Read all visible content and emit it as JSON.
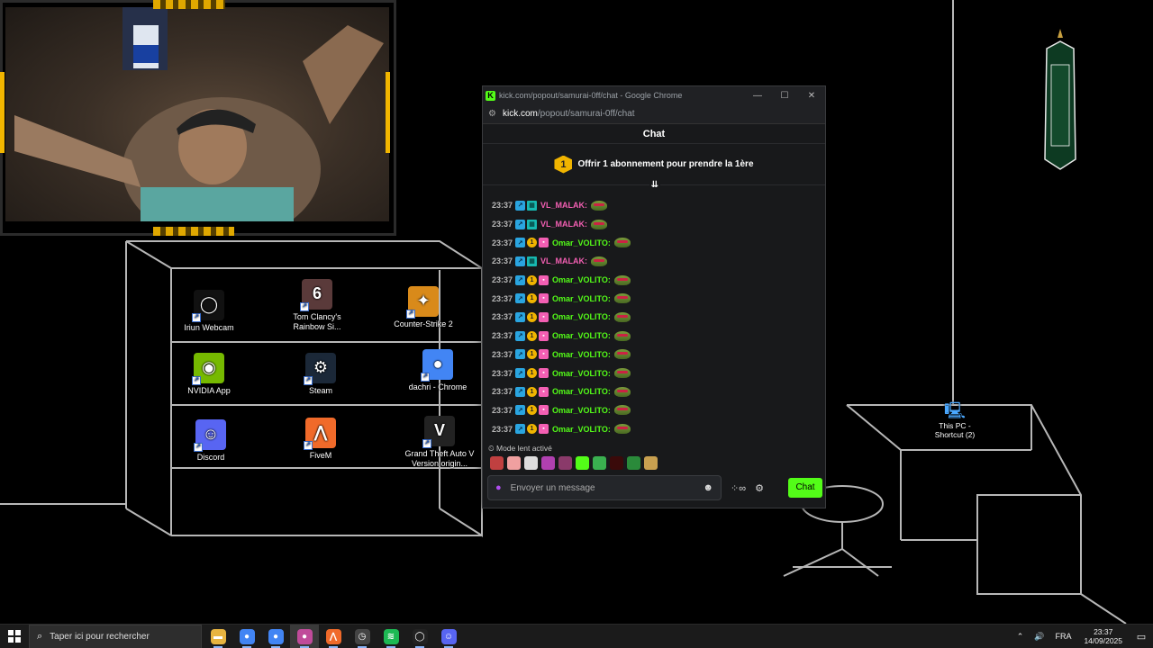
{
  "desktop": {
    "icons": [
      {
        "label": "Iriun Webcam",
        "icon": "webcam-icon",
        "color": "#111",
        "glyph": "◯"
      },
      {
        "label": "Tom Clancy's Rainbow Si...",
        "icon": "rainbow-six-icon",
        "color": "#5a3a3a",
        "glyph": "6"
      },
      {
        "label": "Counter-Strike 2",
        "icon": "counter-strike-icon",
        "color": "#d98a1a",
        "glyph": "✦"
      },
      {
        "label": "NVIDIA App",
        "icon": "nvidia-icon",
        "color": "#76b900",
        "glyph": "◉"
      },
      {
        "label": "Steam",
        "icon": "steam-icon",
        "color": "#1b2838",
        "glyph": "⚙"
      },
      {
        "label": "dachri - Chrome",
        "icon": "chrome-icon",
        "color": "#4285f4",
        "glyph": "●"
      },
      {
        "label": "Discord",
        "icon": "discord-icon",
        "color": "#5865f2",
        "glyph": "☺"
      },
      {
        "label": "FiveM",
        "icon": "fivem-icon",
        "color": "#f06a2a",
        "glyph": "⋀"
      },
      {
        "label": "Grand Theft Auto V Version origin...",
        "icon": "gta-icon",
        "color": "#222",
        "glyph": "V"
      }
    ],
    "this_pc": "This PC - Shortcut (2)"
  },
  "chrome": {
    "window_title": "kick.com/popout/samurai-0ff/chat - Google Chrome",
    "url_host": "kick.com",
    "url_path": "/popout/samurai-0ff/chat",
    "minimize": "—",
    "maximize": "☐",
    "close": "✕"
  },
  "chat": {
    "header": "Chat",
    "gift_count": "1",
    "sub_banner": "Offrir 1 abonnement pour prendre la 1ère",
    "messages": [
      {
        "time": "23:37",
        "user": "VL_MALAK",
        "type": "og",
        "color": "#f35fb3"
      },
      {
        "time": "23:37",
        "user": "VL_MALAK",
        "type": "og",
        "color": "#f35fb3"
      },
      {
        "time": "23:37",
        "user": "Omar_VOLITO",
        "type": "sub",
        "color": "#53fc18"
      },
      {
        "time": "23:37",
        "user": "VL_MALAK",
        "type": "og",
        "color": "#f35fb3"
      },
      {
        "time": "23:37",
        "user": "Omar_VOLITO",
        "type": "sub",
        "color": "#53fc18"
      },
      {
        "time": "23:37",
        "user": "Omar_VOLITO",
        "type": "sub",
        "color": "#53fc18"
      },
      {
        "time": "23:37",
        "user": "Omar_VOLITO",
        "type": "sub",
        "color": "#53fc18"
      },
      {
        "time": "23:37",
        "user": "Omar_VOLITO",
        "type": "sub",
        "color": "#53fc18"
      },
      {
        "time": "23:37",
        "user": "Omar_VOLITO",
        "type": "sub",
        "color": "#53fc18"
      },
      {
        "time": "23:37",
        "user": "Omar_VOLITO",
        "type": "sub",
        "color": "#53fc18"
      },
      {
        "time": "23:37",
        "user": "Omar_VOLITO",
        "type": "sub",
        "color": "#53fc18"
      },
      {
        "time": "23:37",
        "user": "Omar_VOLITO",
        "type": "sub",
        "color": "#53fc18"
      },
      {
        "time": "23:37",
        "user": "Omar_VOLITO",
        "type": "sub",
        "color": "#53fc18"
      }
    ],
    "slow_mode": "Mode lent activé",
    "emote_colors": [
      "#c04040",
      "#f0a0a0",
      "#ddd",
      "#b040b0",
      "#8a3a6a",
      "#53fc18",
      "#3ab050",
      "#3a0a0a",
      "#2a8a3a",
      "#c8a050"
    ],
    "input_placeholder": "Envoyer un message",
    "send_label": "Chat",
    "infinity": "∞"
  },
  "taskbar": {
    "search_placeholder": "Taper ici pour rechercher",
    "apps": [
      {
        "name": "file-explorer-icon",
        "color": "#e8b440",
        "glyph": "▬"
      },
      {
        "name": "chrome-icon",
        "color": "#4285f4",
        "glyph": "●"
      },
      {
        "name": "chrome-icon",
        "color": "#4285f4",
        "glyph": "●"
      },
      {
        "name": "chrome-profile-icon",
        "color": "#c04b9a",
        "glyph": "●"
      },
      {
        "name": "fivem-icon",
        "color": "#f06a2a",
        "glyph": "⋀"
      },
      {
        "name": "clock-app-icon",
        "color": "#444",
        "glyph": "◷"
      },
      {
        "name": "spotify-icon",
        "color": "#1db954",
        "glyph": "≋"
      },
      {
        "name": "webcam-icon",
        "color": "#222",
        "glyph": "◯"
      },
      {
        "name": "discord-icon",
        "color": "#5865f2",
        "glyph": "☺"
      }
    ],
    "language": "FRA",
    "time": "23:37",
    "date": "14/09/2025"
  }
}
